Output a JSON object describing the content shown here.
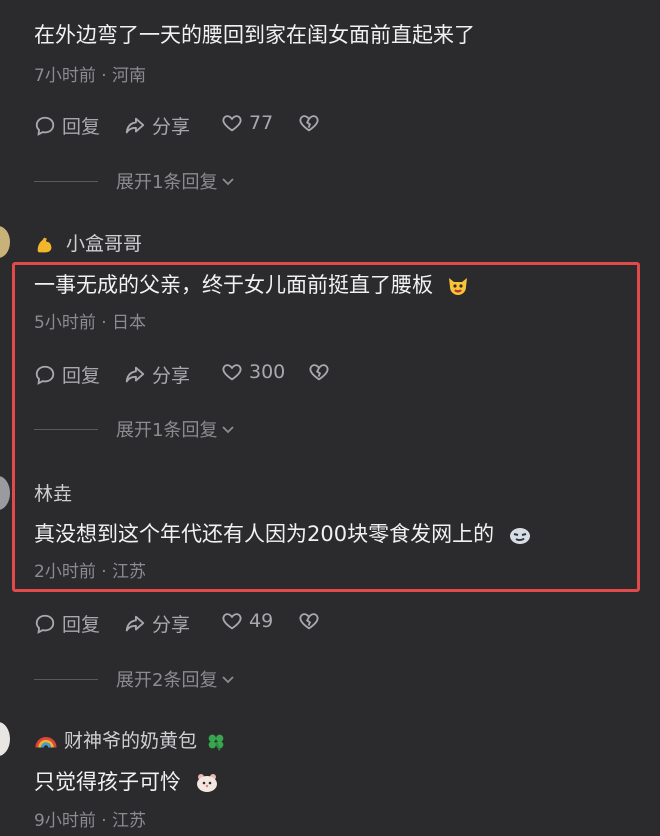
{
  "colors": {
    "background": "#2b2a2d",
    "highlight": "#e04a4a",
    "meta": "#8c8b90"
  },
  "comments": [
    {
      "text": "在外边弯了一天的腰回到家在闺女面前直起来了",
      "time": "7小时前",
      "location": "河南",
      "reply_label": "回复",
      "share_label": "分享",
      "likes": "77",
      "expand": "展开1条回复"
    },
    {
      "username": "小盒哥哥",
      "username_emoji": "flexed-biceps-icon",
      "text": "一事无成的父亲，终于女儿面前挺直了腰板",
      "text_emoji": "cat-face-icon",
      "time": "5小时前",
      "location": "日本",
      "reply_label": "回复",
      "share_label": "分享",
      "likes": "300",
      "expand": "展开1条回复"
    },
    {
      "username": "林垚",
      "text": "真没想到这个年代还有人因为200块零食发网上的",
      "text_emoji": "smirk-face-icon",
      "time": "2小时前",
      "location": "江苏",
      "reply_label": "回复",
      "share_label": "分享",
      "likes": "49",
      "expand": "展开2条回复"
    },
    {
      "username": "财神爷的奶黄包",
      "username_prefix_emoji": "rainbow-icon",
      "username_suffix_emoji": "four-leaf-clover-icon",
      "text": "只觉得孩子可怜",
      "text_emoji": "hamster-face-icon",
      "time": "9小时前",
      "location": "江苏"
    }
  ]
}
